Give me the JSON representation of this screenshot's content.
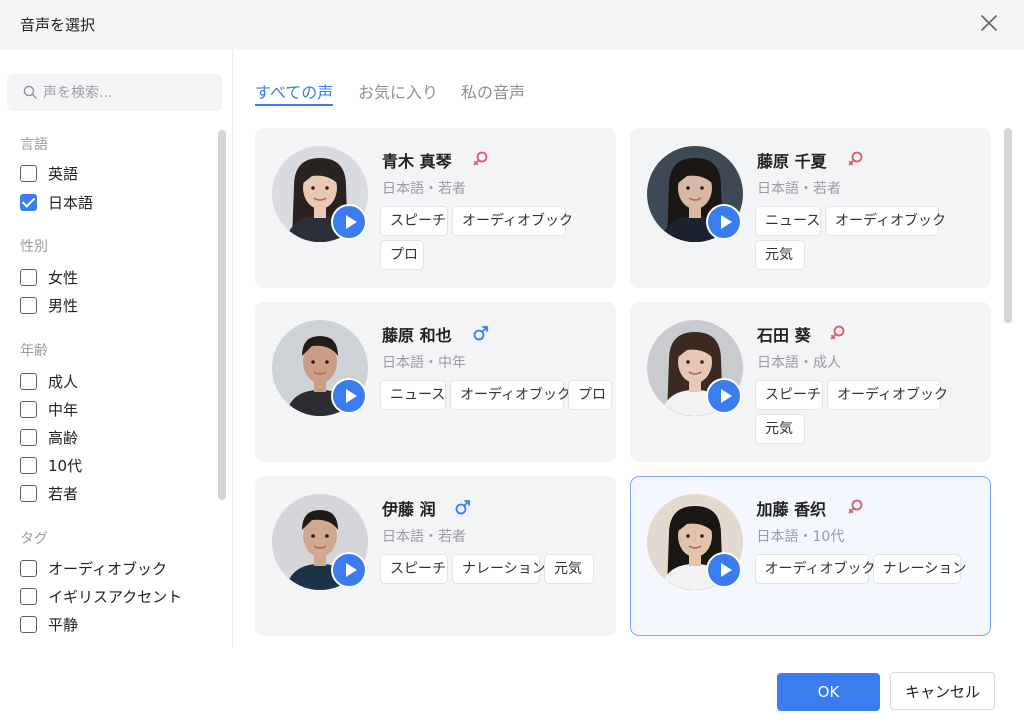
{
  "dialog": {
    "title": "音声を選択",
    "close_icon": "close-icon"
  },
  "search": {
    "placeholder": "声を検索...",
    "value": ""
  },
  "filters": {
    "language": {
      "title": "言語",
      "options": [
        {
          "label": "英語",
          "checked": false
        },
        {
          "label": "日本語",
          "checked": true
        }
      ]
    },
    "gender": {
      "title": "性別",
      "options": [
        {
          "label": "女性",
          "checked": false
        },
        {
          "label": "男性",
          "checked": false
        }
      ]
    },
    "age": {
      "title": "年齢",
      "options": [
        {
          "label": "成人",
          "checked": false
        },
        {
          "label": "中年",
          "checked": false
        },
        {
          "label": "高齢",
          "checked": false
        },
        {
          "label": "10代",
          "checked": false
        },
        {
          "label": "若者",
          "checked": false
        }
      ]
    },
    "tags": {
      "title": "タグ",
      "options": [
        {
          "label": "オーディオブック",
          "checked": false
        },
        {
          "label": "イギリスアクセント",
          "checked": false
        },
        {
          "label": "平静",
          "checked": false
        }
      ]
    }
  },
  "tabs": [
    {
      "label": "すべての声",
      "active": true
    },
    {
      "label": "お気に入り",
      "active": false
    },
    {
      "label": "私の音声",
      "active": false
    }
  ],
  "voices": [
    {
      "name": "青木 真琴",
      "gender": "female",
      "meta": "日本語・若者",
      "tags": [
        "スピーチ",
        "オーディオブック",
        "プロ"
      ],
      "selected": false
    },
    {
      "name": "藤原 千夏",
      "gender": "female",
      "meta": "日本語・若者",
      "tags": [
        "ニュース",
        "オーディオブック",
        "元気"
      ],
      "selected": false
    },
    {
      "name": "藤原 和也",
      "gender": "male",
      "meta": "日本語・中年",
      "tags": [
        "ニュース",
        "オーディオブック",
        "プロ"
      ],
      "selected": false
    },
    {
      "name": "石田 葵",
      "gender": "female",
      "meta": "日本語・成人",
      "tags": [
        "スピーチ",
        "オーディオブック",
        "元気"
      ],
      "selected": false
    },
    {
      "name": "伊藤 润",
      "gender": "male",
      "meta": "日本語・若者",
      "tags": [
        "スピーチ",
        "ナレーション",
        "元気"
      ],
      "selected": false
    },
    {
      "name": "加藤 香织",
      "gender": "female",
      "meta": "日本語・10代",
      "tags": [
        "オーディオブック",
        "ナレーション"
      ],
      "selected": true
    }
  ],
  "colors": {
    "accent": "#3b7cf0",
    "female": "#e05a6a",
    "male": "#3b7cf0"
  },
  "buttons": {
    "ok": "OK",
    "cancel": "キャンセル"
  }
}
